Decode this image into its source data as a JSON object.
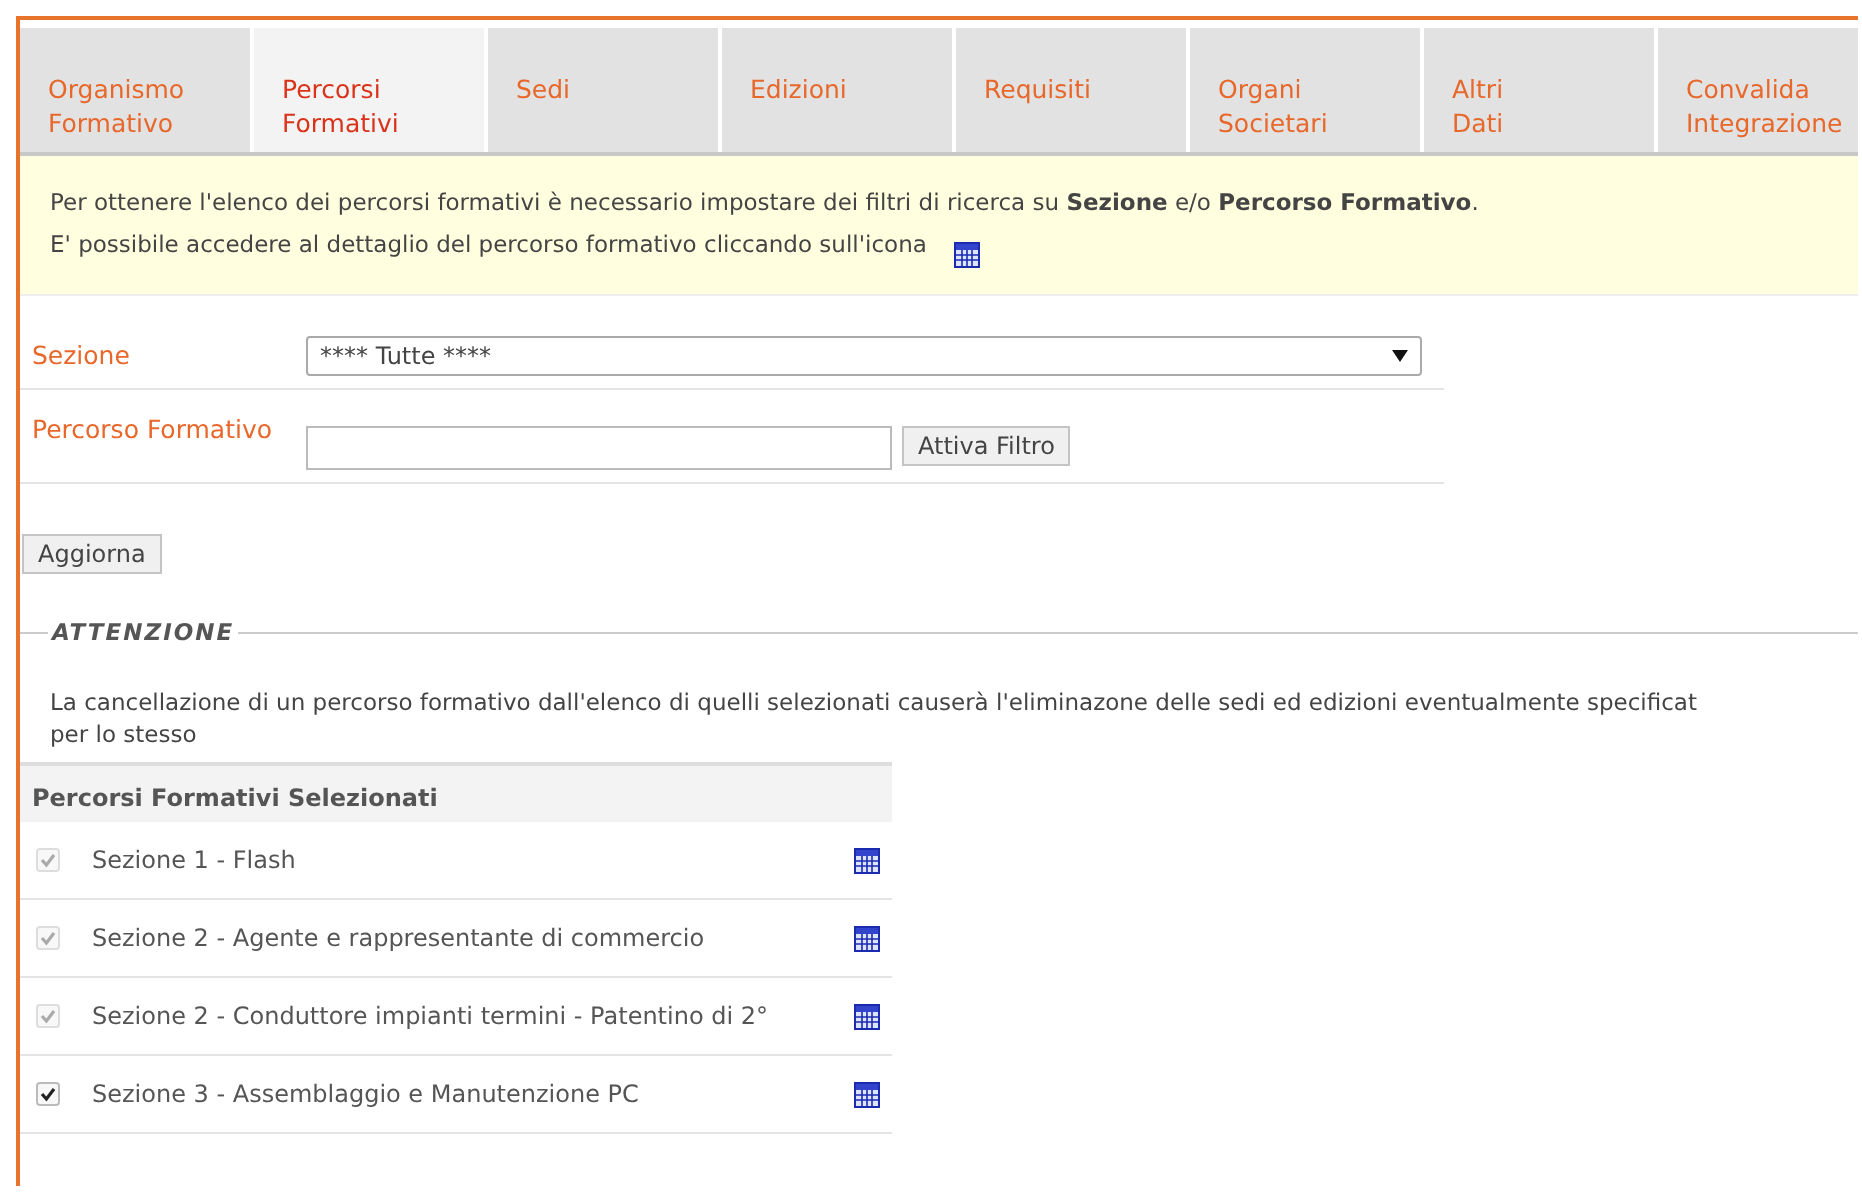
{
  "tabs": [
    {
      "label": "Organismo\nFormativo",
      "selected": false
    },
    {
      "label": "Percorsi\nFormativi",
      "selected": true
    },
    {
      "label": "Sedi",
      "selected": false
    },
    {
      "label": "Edizioni",
      "selected": false
    },
    {
      "label": "Requisiti",
      "selected": false
    },
    {
      "label": "Organi\nSocietari",
      "selected": false
    },
    {
      "label": "Altri\nDati",
      "selected": false
    },
    {
      "label": "Convalida\nIntegrazione",
      "selected": false
    }
  ],
  "info": {
    "lines": [
      "Per ottenere l'elenco dei percorsi formativi è necessario impostare dei filtri di ricerca su **Sezione** e/o **Percorso Formativo**.",
      "E' possibile accedere al dettaglio del percorso formativo cliccando sull'icona"
    ]
  },
  "filters": {
    "sezione_label": "Sezione",
    "sezione_value": "**** Tutte ****",
    "percorso_label": "Percorso Formativo",
    "filter_button": "Attiva Filtro"
  },
  "refresh_button": "Aggiorna",
  "attention": {
    "legend": "ATTENZIONE",
    "lines": [
      "La cancellazione di un percorso formativo dall'elenco di quelli selezionati causerà l'eliminazone delle sedi ed edizioni eventualmente specificat",
      "per lo stesso"
    ]
  },
  "selected_list": {
    "title": "Percorsi Formativi Selezionati",
    "items": [
      {
        "label": "Sezione 1 - Flash",
        "checked": true,
        "disabled": true
      },
      {
        "label": "Sezione 2 - Agente e rappresentante di commercio",
        "checked": true,
        "disabled": true
      },
      {
        "label": "Sezione 2 - Conduttore impianti termini - Patentino di 2°",
        "checked": true,
        "disabled": true
      },
      {
        "label": "Sezione 3 - Assemblaggio e Manutenzione PC",
        "checked": true,
        "disabled": false
      }
    ]
  }
}
